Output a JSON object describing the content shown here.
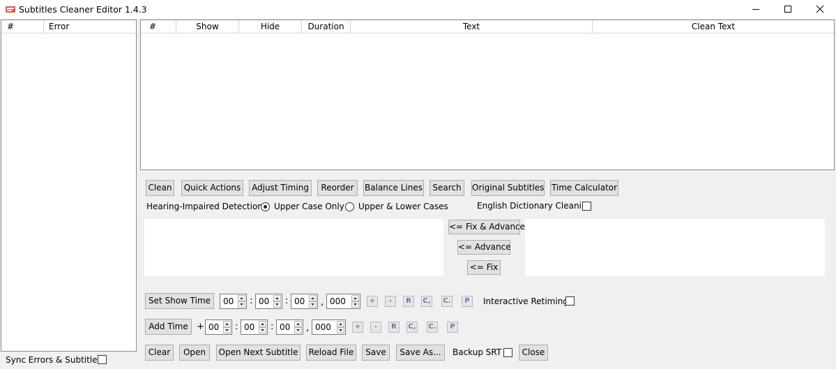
{
  "window": {
    "title": "Subtitles Cleaner Editor 1.4.3"
  },
  "errors_panel": {
    "columns": [
      "#",
      "Error"
    ]
  },
  "subtitles_table": {
    "columns": [
      "#",
      "Show",
      "Hide",
      "Duration",
      "Text",
      "Clean Text"
    ]
  },
  "toolbar": {
    "buttons": [
      "Clean",
      "Quick Actions",
      "Adjust Timing",
      "Reorder",
      "Balance Lines",
      "Search",
      "Original Subtitles",
      "Time Calculator"
    ]
  },
  "detection": {
    "label": "Hearing-Impaired Detection:",
    "option_upper": "Upper Case Only",
    "option_upper_lower": "Upper & Lower Cases",
    "selected": "Upper Case Only",
    "dictionary_label": "English Dictionary Cleaning",
    "dictionary_checked": false
  },
  "fix_buttons": {
    "fix_advance": "<= Fix & Advance",
    "advance": "<= Advance",
    "fix": "<= Fix"
  },
  "show_time": {
    "button": "Set Show Time",
    "h": "00",
    "m": "00",
    "s": "00",
    "ms": "000",
    "colon": ":",
    "comma": ",",
    "actions": [
      "+",
      "-",
      "R",
      "C,",
      "C.",
      "P"
    ],
    "interactive_label": "Interactive Retiming",
    "interactive_checked": false
  },
  "add_time": {
    "button": "Add Time",
    "sign": "+",
    "h": "00",
    "m": "00",
    "s": "00",
    "ms": "000",
    "actions": [
      "+",
      "-",
      "R",
      "C,",
      "C.",
      "P"
    ]
  },
  "bottom_bar": {
    "clear": "Clear",
    "open": "Open",
    "open_next": "Open Next Subtitle",
    "reload": "Reload File",
    "save": "Save",
    "save_as": "Save As...",
    "backup_label": "Backup SRT",
    "backup_checked": false,
    "close": "Close"
  },
  "sync": {
    "label": "Sync Errors & Subtitles",
    "checked": false
  }
}
